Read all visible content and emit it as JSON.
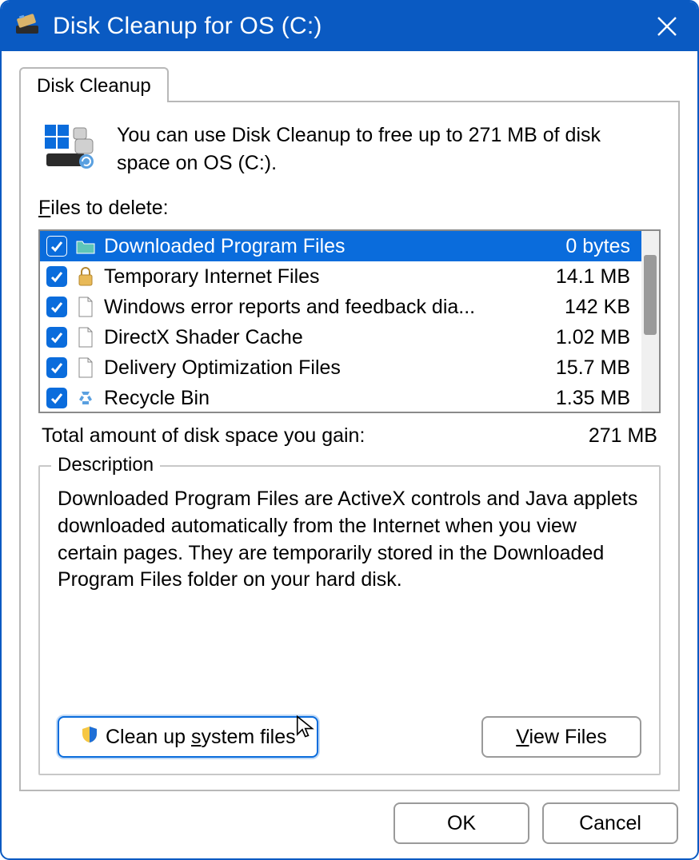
{
  "window": {
    "title": "Disk Cleanup for OS (C:)"
  },
  "tab": {
    "label": "Disk Cleanup"
  },
  "summary": {
    "text": "You can use Disk Cleanup to free up to 271 MB of disk space on OS (C:)."
  },
  "files_label_prefix": "F",
  "files_label_rest": "iles to delete:",
  "items": [
    {
      "name": "Downloaded Program Files",
      "size": "0 bytes",
      "selected": true,
      "checked": true,
      "icon": "folder"
    },
    {
      "name": "Temporary Internet Files",
      "size": "14.1 MB",
      "selected": false,
      "checked": true,
      "icon": "lock"
    },
    {
      "name": "Windows error reports and feedback dia...",
      "size": "142 KB",
      "selected": false,
      "checked": true,
      "icon": "file"
    },
    {
      "name": "DirectX Shader Cache",
      "size": "1.02 MB",
      "selected": false,
      "checked": true,
      "icon": "file"
    },
    {
      "name": "Delivery Optimization Files",
      "size": "15.7 MB",
      "selected": false,
      "checked": true,
      "icon": "file"
    },
    {
      "name": "Recycle Bin",
      "size": "1.35 MB",
      "selected": false,
      "checked": true,
      "icon": "recycle"
    }
  ],
  "total": {
    "label": "Total amount of disk space you gain:",
    "value": "271 MB"
  },
  "description": {
    "legend": "Description",
    "text": "Downloaded Program Files are ActiveX controls and Java applets downloaded automatically from the Internet when you view certain pages. They are temporarily stored in the Downloaded Program Files folder on your hard disk."
  },
  "buttons": {
    "clean_prefix": "Clean up ",
    "clean_ul": "s",
    "clean_suffix": "ystem files",
    "view_ul": "V",
    "view_suffix": "iew Files",
    "ok": "OK",
    "cancel": "Cancel"
  }
}
